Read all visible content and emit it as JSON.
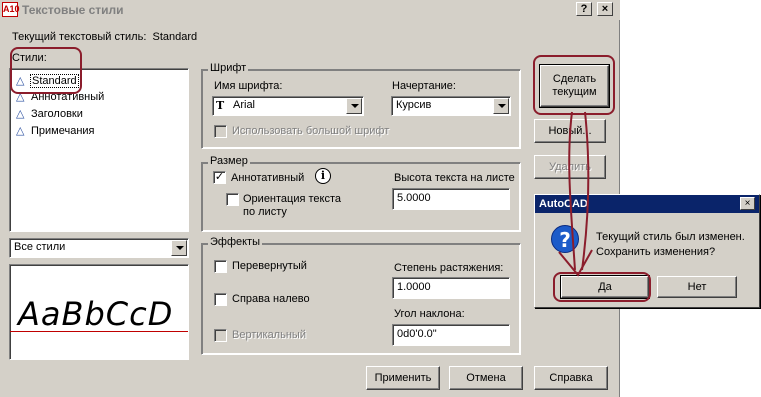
{
  "window": {
    "title": "Текстовые стили",
    "logo_text": "A10",
    "help_glyph": "?",
    "close_glyph": "×"
  },
  "current_style": {
    "label": "Текущий текстовый стиль:",
    "value": "Standard"
  },
  "styles": {
    "label": "Стили:",
    "items": [
      {
        "label": "Standard",
        "selected": true
      },
      {
        "label": "Аннотативный"
      },
      {
        "label": "Заголовки"
      },
      {
        "label": "Примечания"
      }
    ],
    "filter_value": "Все стили"
  },
  "preview": {
    "sample": "AaBbCcD"
  },
  "font_group": {
    "label": "Шрифт",
    "name_label": "Имя шрифта:",
    "name_value": "Arial",
    "tt_glyph": "T",
    "style_label": "Начертание:",
    "style_value": "Курсив",
    "big_font_label": "Использовать большой шрифт"
  },
  "size_group": {
    "label": "Размер",
    "annotative_label": "Аннотативный",
    "annotative_checked": true,
    "check_glyph": "✓",
    "info_glyph": "i",
    "orientation_label_1": "Ориентация текста",
    "orientation_label_2": "по листу",
    "height_label": "Высота текста на листе",
    "height_value": "5.0000"
  },
  "effects_group": {
    "label": "Эффекты",
    "upside_down_label": "Перевернутый",
    "backwards_label": "Справа налево",
    "vertical_label": "Вертикальный",
    "width_factor_label": "Степень растяжения:",
    "width_factor_value": "1.0000",
    "oblique_label": "Угол наклона:",
    "oblique_value": "0d0'0.0\""
  },
  "buttons": {
    "set_current_1": "Сделать",
    "set_current_2": "текущим",
    "new": "Новый...",
    "delete": "Удалить",
    "apply": "Применить",
    "cancel": "Отмена",
    "help": "Справка"
  },
  "message_box": {
    "title": "AutoCAD",
    "close_glyph": "×",
    "icon_glyph": "?",
    "line1": "Текущий стиль был изменен.",
    "line2": "Сохранить изменения?",
    "yes": "Да",
    "no": "Нет"
  },
  "colors": {
    "highlight": "#8b1d2c",
    "dialog_bg": "#d4d0c8",
    "titlebar_active": "#0a246a"
  }
}
